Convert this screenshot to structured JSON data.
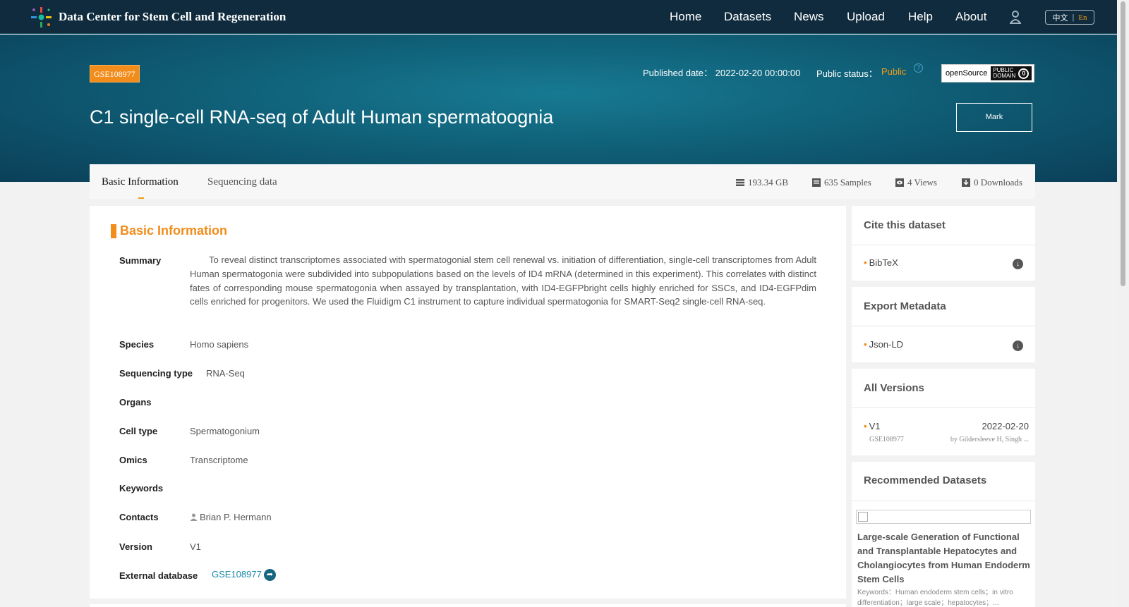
{
  "header": {
    "site_title": "Data Center for Stem Cell and Regeneration",
    "nav": [
      "Home",
      "Datasets",
      "News",
      "Upload",
      "Help",
      "About"
    ],
    "lang_zh": "中文",
    "lang_sep": "|",
    "lang_en": "En"
  },
  "hero": {
    "accession": "GSE108977",
    "published_label": "Published date：",
    "published_value": "2022-02-20 00:00:00",
    "status_label": "Public status：",
    "status_value": "Public",
    "help_glyph": "?",
    "open_source_label": "openSource",
    "public_domain_line1": "PUBLIC",
    "public_domain_line2": "DOMAIN",
    "public_domain_glyph": "0",
    "title": "C1 single-cell RNA-seq of Adult Human spermatoognia",
    "mark_label": "Mark"
  },
  "tabs": {
    "basic": "Basic Information",
    "sequencing": "Sequencing data"
  },
  "stats": {
    "size": "193.34 GB",
    "samples": "635 Samples",
    "views": "4 Views",
    "downloads": "0 Downloads"
  },
  "basic_info": {
    "section_title": "Basic Information",
    "summary_label": "Summary",
    "summary": "To reveal distinct transcriptomes associated with spermatogonial stem cell renewal vs. initiation of differentiation, single-cell transcriptomes from Adult Human spermatogonia were subdivided into subpopulations based on the levels of ID4 mRNA (determined in this experiment). This correlates with distinct fates of corresponding mouse spermatogonia when assayed by transplantation, with ID4-EGFPbright cells highly enriched for SSCs, and ID4-EGFPdim cells enriched for progenitors. We used the Fluidigm C1 instrument to capture individual spermatogonia for SMART-Seq2 single-cell RNA-seq.",
    "species_label": "Species",
    "species": "Homo sapiens",
    "seqtype_label": "Sequencing type",
    "seqtype": "RNA-Seq",
    "organs_label": "Organs",
    "celltype_label": "Cell type",
    "celltype": "Spermatogonium",
    "omics_label": "Omics",
    "omics": "Transcriptome",
    "keywords_label": "Keywords",
    "contacts_label": "Contacts",
    "contact": "Brian P. Hermann",
    "version_label": "Version",
    "version": "V1",
    "extdb_label": "External database",
    "extdb": "GSE108977",
    "extdb_glyph": "➦"
  },
  "sidebar": {
    "cite_title": "Cite this dataset",
    "bibtex": "BibTeX",
    "export_title": "Export Metadata",
    "jsonld": "Json-LD",
    "download_glyph": "↓",
    "bullet_glyph": "•",
    "versions_title": "All Versions",
    "version_name": "V1",
    "version_date": "2022-02-20",
    "version_accession": "GSE108977",
    "version_authors": "by Gildersleeve H, Singh ...",
    "recommended_title": "Recommended Datasets",
    "rec_title": "Large-scale Generation of Functional and Transplantable Hepatocytes and Cholangiocytes from Human Endoderm Stem Cells",
    "rec_keywords": "Keywords：Human endoderm stem cells；in vitro differentiation；large scale；hepatocytes；..."
  },
  "colors": {
    "nav_bg": "#0f2b3d",
    "accent": "#f28c1a",
    "link": "#1a8aa8"
  }
}
